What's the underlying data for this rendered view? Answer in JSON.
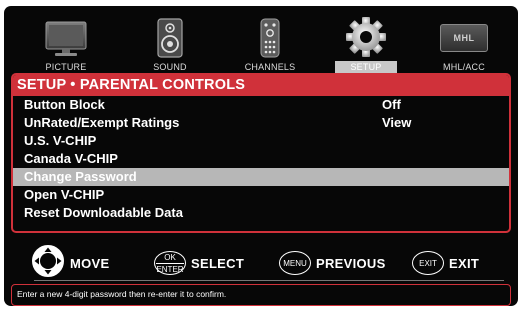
{
  "categories": [
    {
      "label": "PICTURE",
      "icon": "tv-icon",
      "active": false
    },
    {
      "label": "SOUND",
      "icon": "speaker-icon",
      "active": false
    },
    {
      "label": "CHANNELS",
      "icon": "remote-icon",
      "active": false
    },
    {
      "label": "SETUP",
      "icon": "gear-icon",
      "active": true
    },
    {
      "label": "MHL/ACC",
      "icon": "mhl-logo-icon",
      "active": false
    }
  ],
  "mhl_logo_text": "MHL",
  "panel": {
    "title": "SETUP • PARENTAL CONTROLS",
    "items": [
      {
        "label": "Button Block",
        "value": "Off",
        "selected": false
      },
      {
        "label": "UnRated/Exempt Ratings",
        "value": "View",
        "selected": false
      },
      {
        "label": "U.S. V-CHIP",
        "value": "",
        "selected": false
      },
      {
        "label": "Canada V-CHIP",
        "value": "",
        "selected": false
      },
      {
        "label": "Change Password",
        "value": "",
        "selected": true
      },
      {
        "label": "Open V-CHIP",
        "value": "",
        "selected": false
      },
      {
        "label": "Reset Downloadable Data",
        "value": "",
        "selected": false
      }
    ]
  },
  "hints": {
    "move": "MOVE",
    "select_btn_top": "OK",
    "select_btn_bottom": "ENTER",
    "select": "SELECT",
    "menu_btn": "MENU",
    "previous": "PREVIOUS",
    "exit_btn": "EXIT",
    "exit": "EXIT"
  },
  "info": "Enter a new 4-digit password then re-enter it to confirm.",
  "colors": {
    "accent": "#d0313a",
    "highlight": "#b7b7b7",
    "background": "#070707"
  }
}
